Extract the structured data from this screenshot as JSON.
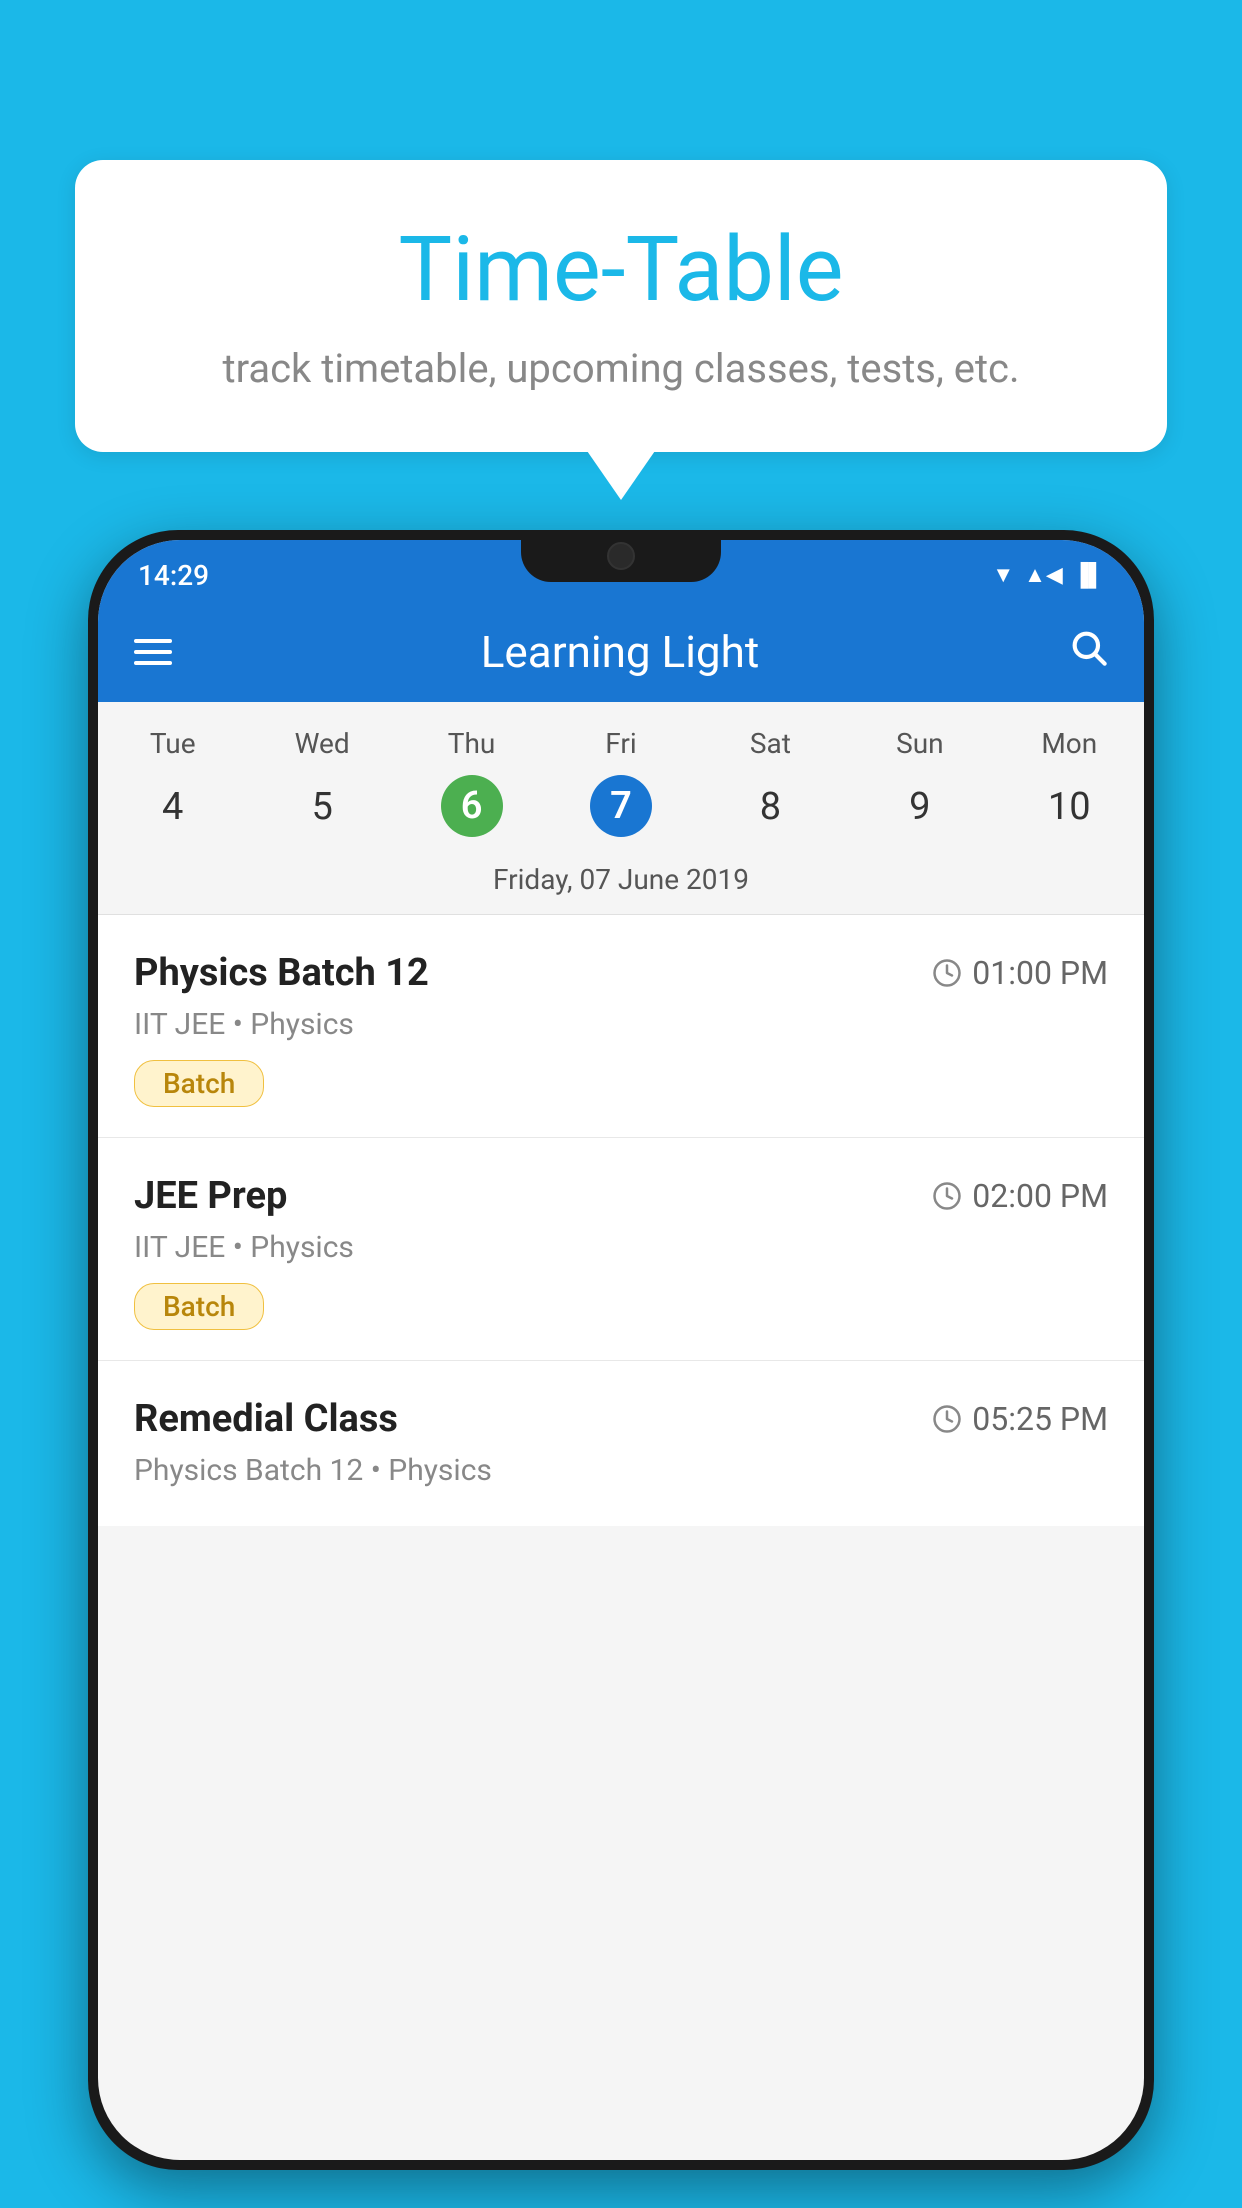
{
  "background": {
    "color": "#1bb8e8"
  },
  "speech_bubble": {
    "title": "Time-Table",
    "subtitle": "track timetable, upcoming classes, tests, etc."
  },
  "phone": {
    "status_bar": {
      "time": "14:29",
      "wifi": "▼",
      "signal": "▲",
      "battery": "▐"
    },
    "toolbar": {
      "title": "Learning Light",
      "menu_icon": "menu",
      "search_icon": "search"
    },
    "calendar": {
      "days": [
        {
          "label": "Tue",
          "number": "4"
        },
        {
          "label": "Wed",
          "number": "5"
        },
        {
          "label": "Thu",
          "number": "6",
          "state": "today"
        },
        {
          "label": "Fri",
          "number": "7",
          "state": "selected"
        },
        {
          "label": "Sat",
          "number": "8"
        },
        {
          "label": "Sun",
          "number": "9"
        },
        {
          "label": "Mon",
          "number": "10"
        }
      ],
      "selected_date_label": "Friday, 07 June 2019"
    },
    "schedule": [
      {
        "title": "Physics Batch 12",
        "time": "01:00 PM",
        "subtitle": "IIT JEE • Physics",
        "tag": "Batch"
      },
      {
        "title": "JEE Prep",
        "time": "02:00 PM",
        "subtitle": "IIT JEE • Physics",
        "tag": "Batch"
      },
      {
        "title": "Remedial Class",
        "time": "05:25 PM",
        "subtitle": "Physics Batch 12 • Physics",
        "tag": ""
      }
    ]
  }
}
